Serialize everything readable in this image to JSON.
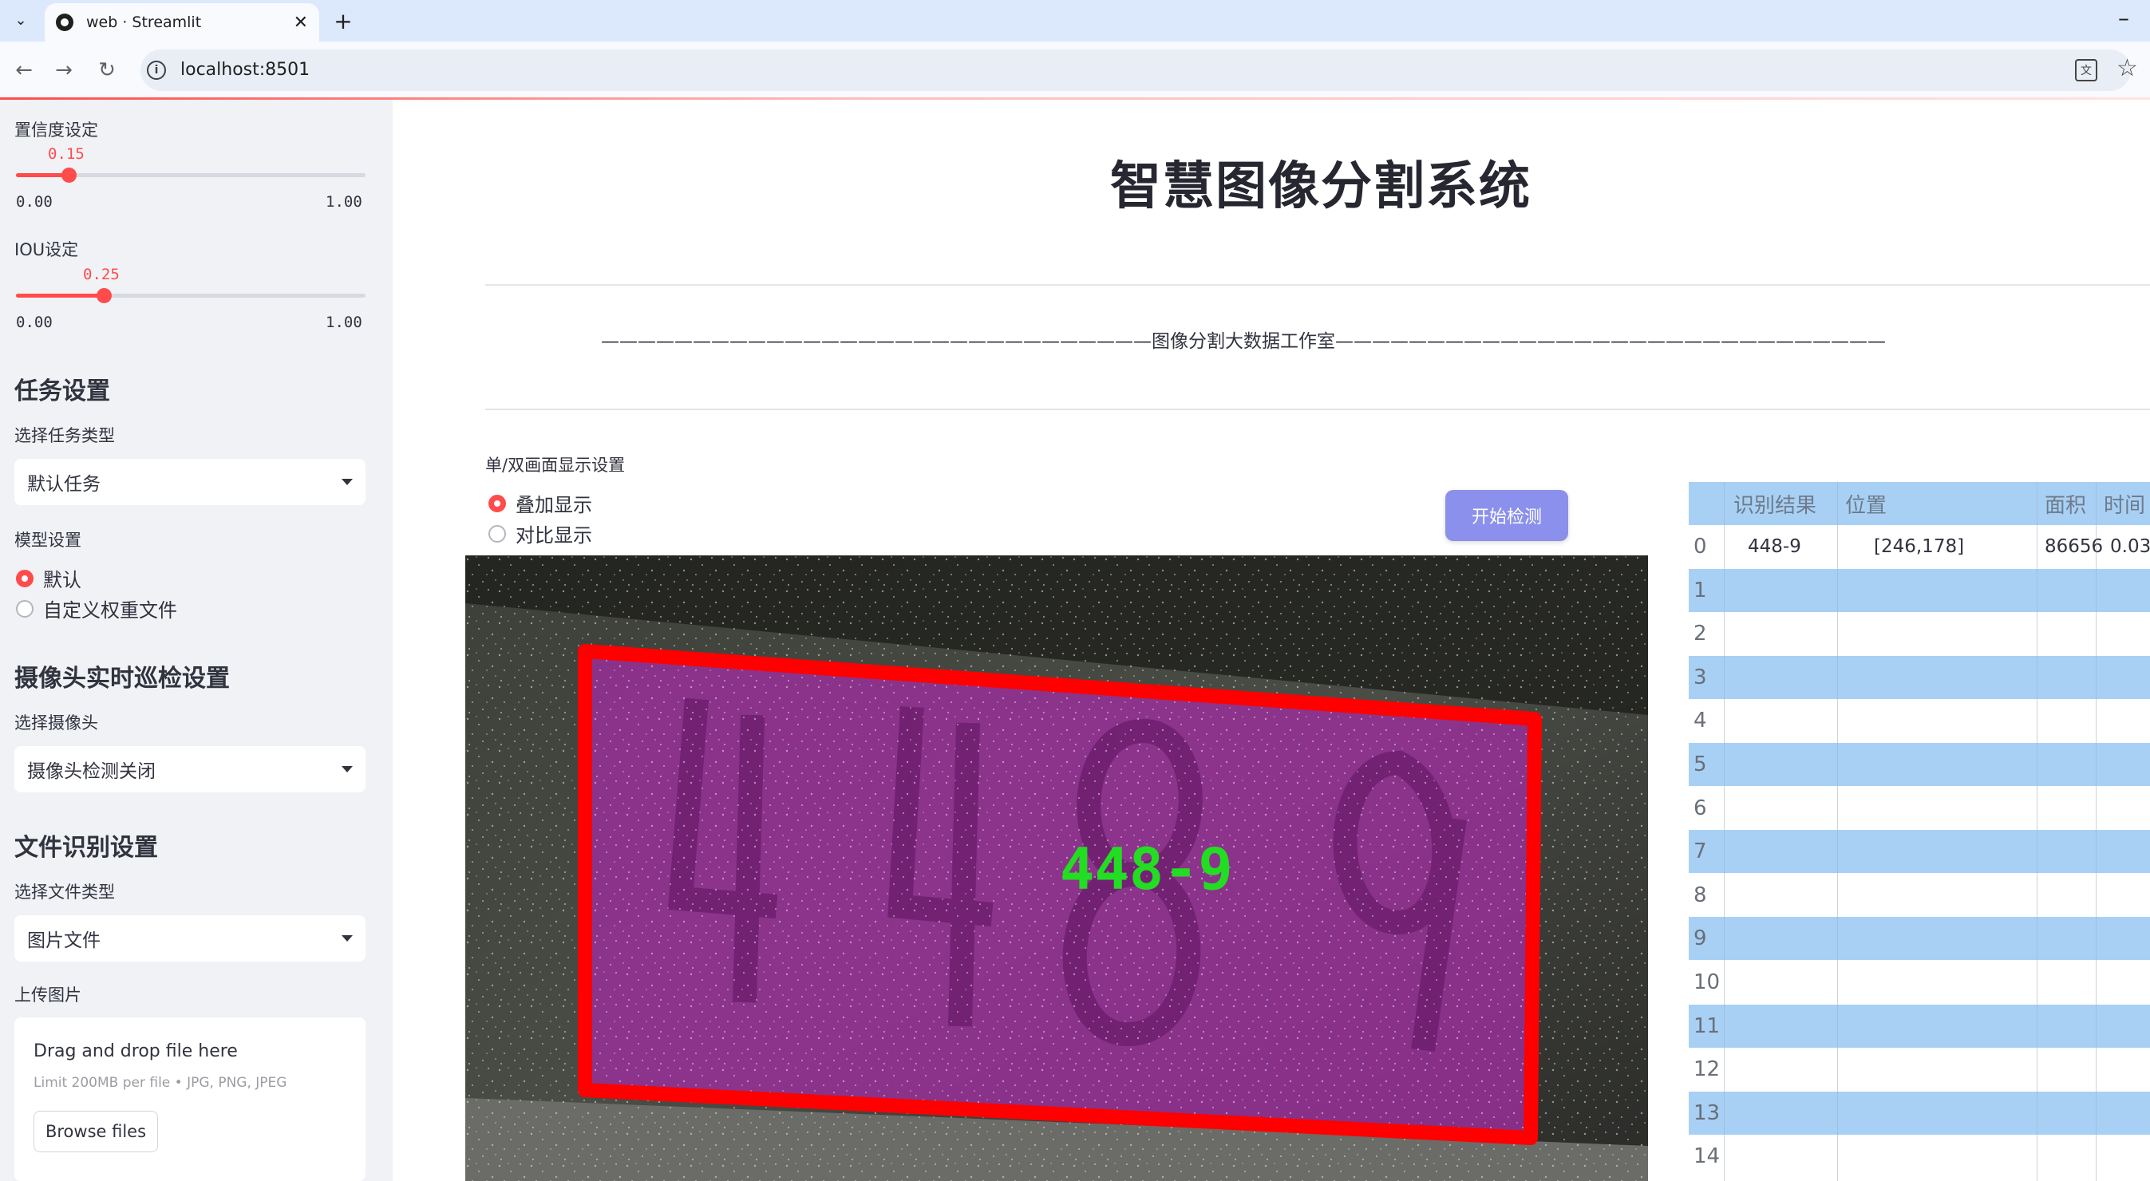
{
  "browser": {
    "tab_title": "web · Streamlit",
    "url": "localhost:8501"
  },
  "sidebar": {
    "confidence": {
      "label": "置信度设定",
      "value": "0.15",
      "min": "0.00",
      "max": "1.00",
      "fraction": 0.15
    },
    "iou": {
      "label": "IOU设定",
      "value": "0.25",
      "min": "0.00",
      "max": "1.00",
      "fraction": 0.25
    },
    "task_section": "任务设置",
    "task_type_label": "选择任务类型",
    "task_type_value": "默认任务",
    "model_label": "模型设置",
    "model_options": [
      "默认",
      "自定义权重文件"
    ],
    "camera_section": "摄像头实时巡检设置",
    "camera_label": "选择摄像头",
    "camera_value": "摄像头检测关闭",
    "file_section": "文件识别设置",
    "file_type_label": "选择文件类型",
    "file_type_value": "图片文件",
    "upload_label": "上传图片",
    "upload_title": "Drag and drop file here",
    "upload_hint": "Limit 200MB per file • JPG, PNG, JPEG",
    "upload_button": "Browse files"
  },
  "main": {
    "title": "智慧图像分割系统",
    "studio": "——————————————————————————————图像分割大数据工作室——————————————————————————————",
    "display_label": "单/双画面显示设置",
    "display_options": [
      "叠加显示",
      "对比显示"
    ],
    "start_button": "开始检测",
    "detection_label": "448-9"
  },
  "table": {
    "headers": [
      "识别结果",
      "位置",
      "面积",
      "时间"
    ],
    "rows": [
      {
        "idx": "0",
        "result": "448-9",
        "pos": "[246,178]",
        "area": "86656",
        "time": "0.03"
      },
      {
        "idx": "1"
      },
      {
        "idx": "2"
      },
      {
        "idx": "3"
      },
      {
        "idx": "4"
      },
      {
        "idx": "5"
      },
      {
        "idx": "6"
      },
      {
        "idx": "7"
      },
      {
        "idx": "8"
      },
      {
        "idx": "9"
      },
      {
        "idx": "10"
      },
      {
        "idx": "11"
      },
      {
        "idx": "12"
      },
      {
        "idx": "13"
      },
      {
        "idx": "14"
      }
    ]
  },
  "colors": {
    "accent": "#ff4b4b",
    "button": "#8b90ec",
    "table_band": "#a8d0f5",
    "overlay": "#9b2e9b",
    "box": "#ff0000",
    "label": "#22dd22"
  }
}
